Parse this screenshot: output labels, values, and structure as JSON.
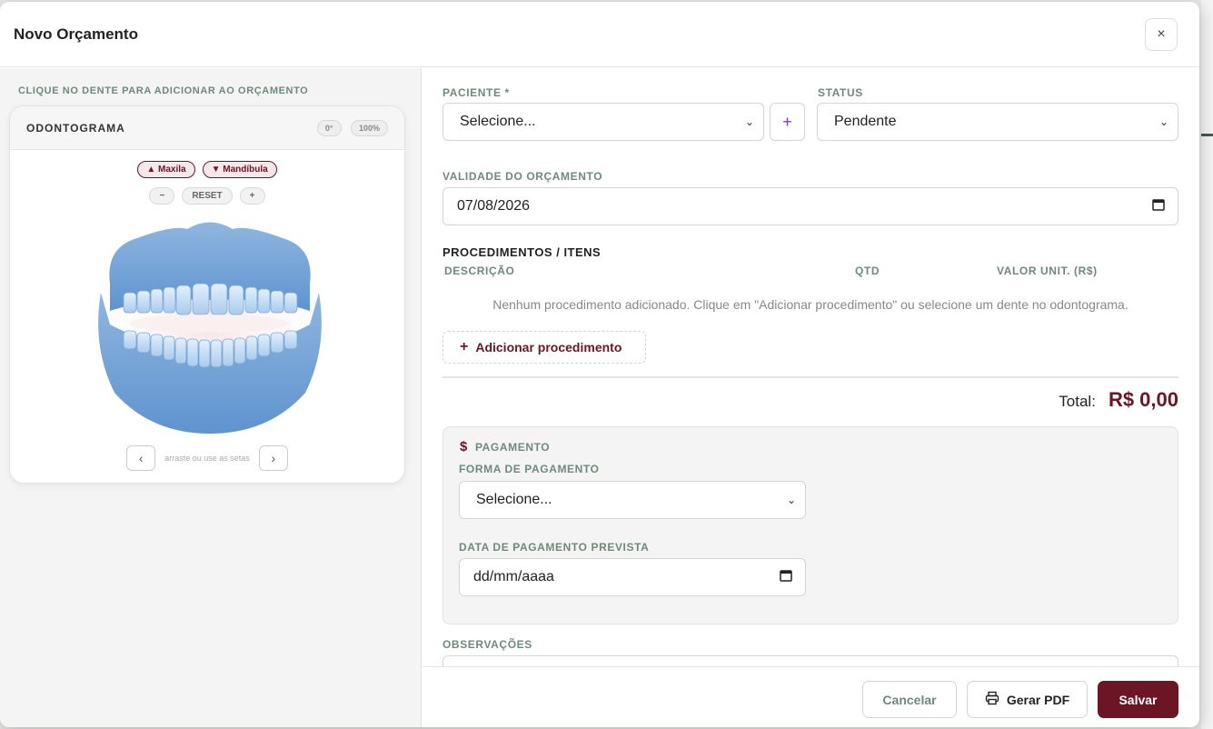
{
  "modal": {
    "title": "Novo Orçamento",
    "close_label": "×"
  },
  "left": {
    "hint": "CLIQUE NO DENTE PARA ADICIONAR AO ORÇAMENTO",
    "odontogram": {
      "title": "ODONTOGRAMA",
      "rotation": "0°",
      "zoom": "100%",
      "maxila_label": "▲ Maxila",
      "mandibula_label": "▼ Mandíbula",
      "zoom_out": "−",
      "reset": "RESET",
      "zoom_in": "+",
      "prev": "‹",
      "next": "›",
      "nav_hint": "arraste ou use as setas"
    }
  },
  "form": {
    "patient_label": "PACIENTE *",
    "patient_value": "Selecione...",
    "add_patient": "+",
    "status_label": "STATUS",
    "status_value": "Pendente",
    "validity_label": "VALIDADE DO ORÇAMENTO",
    "validity_value": "07/08/2026",
    "procedures_title": "PROCEDIMENTOS / ITENS",
    "col_description": "DESCRIÇÃO",
    "col_qty": "QTD",
    "col_unit_value": "VALOR UNIT. (R$)",
    "empty_message": "Nenhum procedimento adicionado. Clique em \"Adicionar procedimento\" ou selecione um dente no odontograma.",
    "add_procedure": "Adicionar procedimento",
    "total_label": "Total:",
    "total_value": "R$ 0,00",
    "payment": {
      "title": "PAGAMENTO",
      "method_label": "FORMA DE PAGAMENTO",
      "method_value": "Selecione...",
      "date_label": "DATA DE PAGAMENTO PREVISTA",
      "date_value": "dd/mm/aaaa"
    },
    "notes_label": "OBSERVAÇÕES"
  },
  "footer": {
    "cancel": "Cancelar",
    "pdf": "Gerar PDF",
    "save": "Salvar"
  },
  "colors": {
    "accent": "#6b1525",
    "label": "#6f8a7b",
    "plus": "#7a3cc7"
  }
}
